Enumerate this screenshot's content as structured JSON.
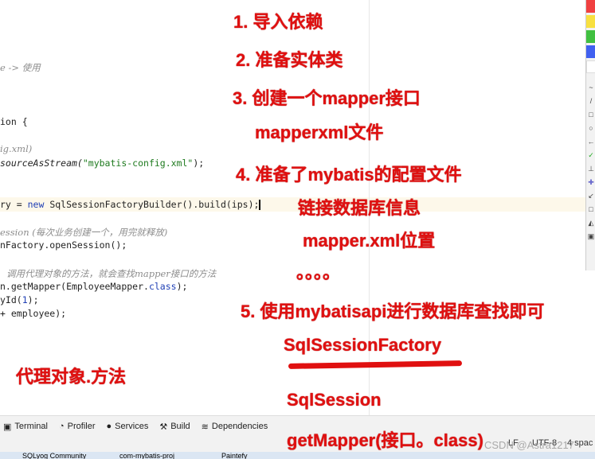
{
  "code_lines": {
    "l1_comment": "e -> 使用",
    "l2": "ion {",
    "l3_comment": "ig.xml)",
    "l4_pre": "sourceAsStream(",
    "l4_str": "\"mybatis-config.xml\"",
    "l4_post": ");",
    "l5_pre": "ry = ",
    "l5_kw": "new",
    "l5_post": " SqlSessionFactoryBuilder().build(ips);",
    "l6_comment": "ession (每次业务创建一个，用完就释放)",
    "l7": "nFactory.openSession();",
    "l8_comment": "调用代理对象的方法，就会查找mapper接口的方法",
    "l9_pre": "n.getMapper(EmployeeMapper.",
    "l9_kw": "class",
    "l9_post": ");",
    "l10_pre": "yId(",
    "l10_num": "1",
    "l10_post": ");",
    "l11": "+ employee);"
  },
  "annotations": {
    "a1": "1. 导入依赖",
    "a2": "2. 准备实体类",
    "a3": "3. 创建一个mapper接口",
    "a3b": "mapperxml文件",
    "a4": "4. 准备了mybatis的配置文件",
    "a4b": "链接数据库信息",
    "a4c": "mapper.xml位置",
    "a4d": "。。。。",
    "a5": "5. 使用mybatisapi进行数据库查找即可",
    "a5b": "SqlSessionFactory",
    "a5c": "SqlSession",
    "a5d": "getMapper(接口。class)",
    "proxy": "代理对象.方法"
  },
  "annotation_color": "#e01010",
  "palette_colors": [
    "#f04040",
    "#f8e040",
    "#40c040",
    "#4060f0",
    "#ffffff"
  ],
  "tool_windows": [
    {
      "label": "Terminal",
      "icon": "terminal-icon"
    },
    {
      "label": "Profiler",
      "icon": "profiler-icon"
    },
    {
      "label": "Services",
      "icon": "services-icon"
    },
    {
      "label": "Build",
      "icon": "hammer-icon"
    },
    {
      "label": "Dependencies",
      "icon": "dependencies-icon"
    }
  ],
  "status": {
    "line_sep": "LF",
    "encoding": "UTF-8",
    "indent": "4 spac"
  },
  "watermark": "CSDN @Astra1217",
  "taskbar": [
    "SQLyog Community",
    "com-mybatis-proj",
    "Paintefy"
  ]
}
